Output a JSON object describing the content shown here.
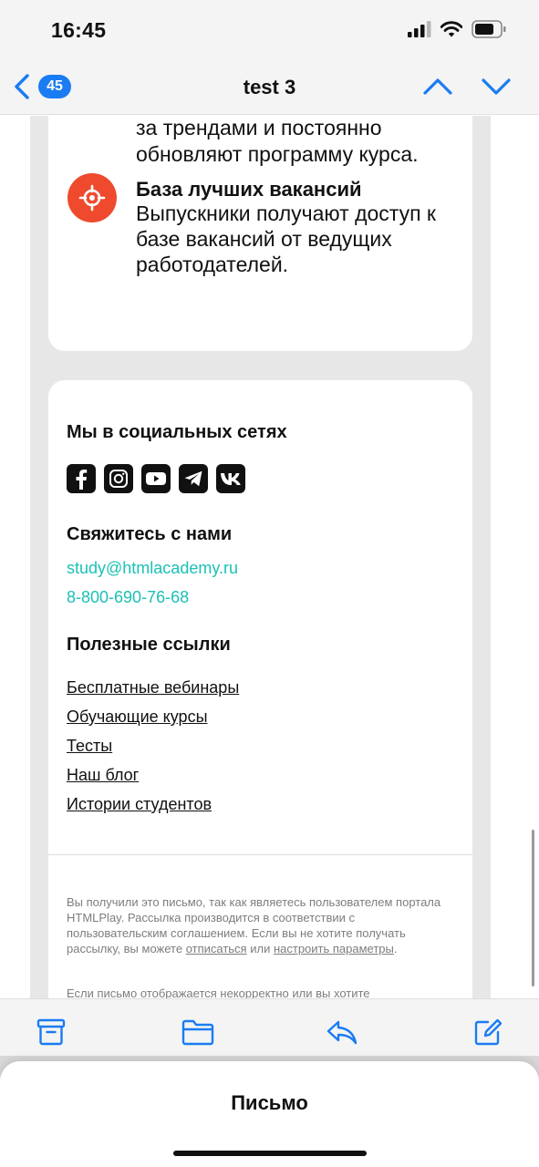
{
  "status_bar": {
    "time": "16:45",
    "icons": [
      "signal-icon",
      "wifi-icon",
      "battery-icon"
    ]
  },
  "nav": {
    "back_count": "45",
    "title": "test 3",
    "icons": [
      "back-chevron-icon",
      "chevron-up-icon",
      "chevron-down-icon"
    ]
  },
  "mail": {
    "trend_text_line1": "за трендами и постоянно",
    "trend_text_line2": "обновляют программу курса.",
    "feature": {
      "icon": "target-icon",
      "title": "База лучших вакансий",
      "desc": "Выпускники получают доступ к базе вакансий от ведущих работодателей."
    },
    "social": {
      "heading": "Мы в социальных сетях",
      "icons": [
        "facebook-icon",
        "instagram-icon",
        "youtube-icon",
        "telegram-icon",
        "vk-icon"
      ]
    },
    "contact": {
      "heading": "Свяжитесь с нами",
      "email": "study@htmlacademy.ru",
      "phone": "8-800-690-76-68"
    },
    "links": {
      "heading": "Полезные ссылки",
      "items": [
        "Бесплатные вебинары",
        "Обучающие курсы",
        "Тесты",
        "Наш блог",
        "Истории студентов"
      ]
    },
    "disclaimer": {
      "text": "Вы получили это письмо, так как являетесь пользователем портала HTMLPlay. Рассылка производится в соответствии с пользовательским соглашением. Если вы не хотите получать рассылку, вы можете ",
      "unsubscribe": "отписаться",
      "or": " или ",
      "settings": "настроить параметры",
      "end": ".",
      "second": "Если письмо отображается некорректно или вы хотите"
    }
  },
  "toolbar": {
    "icons": [
      "archive-icon",
      "folder-icon",
      "reply-icon",
      "compose-icon"
    ]
  },
  "sheet": {
    "title": "Письмо"
  },
  "colors": {
    "accent": "#1a7cf2",
    "feature_icon": "#ef4a2d",
    "contact_link": "#1bc1b6"
  }
}
